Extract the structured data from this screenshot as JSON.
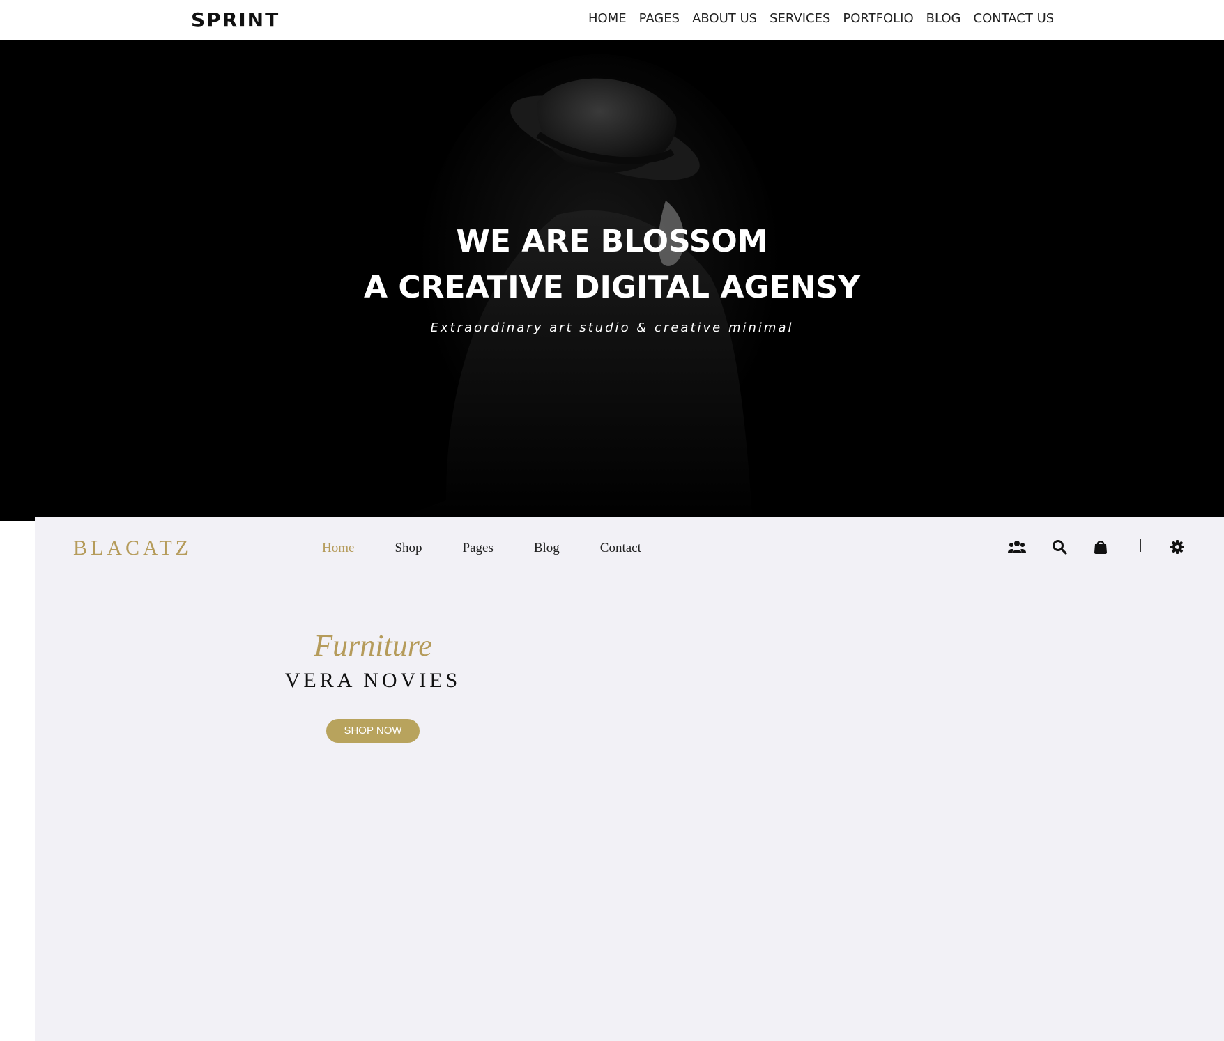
{
  "sprint": {
    "logo": "SPRINT",
    "nav": [
      "HOME",
      "PAGES",
      "ABOUT US",
      "SERVICES",
      "PORTFOLIO",
      "BLOG",
      "CONTACT US"
    ],
    "hero": {
      "line1": "WE ARE BLOSSOM",
      "line2": "A CREATIVE DIGITAL AGENSY",
      "subtitle": "Extraordinary art studio & creative minimal"
    }
  },
  "blacatz": {
    "logo": "BLACATZ",
    "nav": [
      "Home",
      "Shop",
      "Pages",
      "Blog",
      "Contact"
    ],
    "active_nav": "Home",
    "icons": [
      "users-icon",
      "search-icon",
      "shopping-bag-icon",
      "gear-icon"
    ],
    "promo": {
      "script": "Furniture",
      "title": "VERA NOVIES",
      "button": "SHOP NOW"
    }
  },
  "colors": {
    "gold_accent": "#b59b5a",
    "button_bg": "#b8a35d",
    "hero_bg": "#000000",
    "blacatz_bg": "#f2f1f6"
  }
}
